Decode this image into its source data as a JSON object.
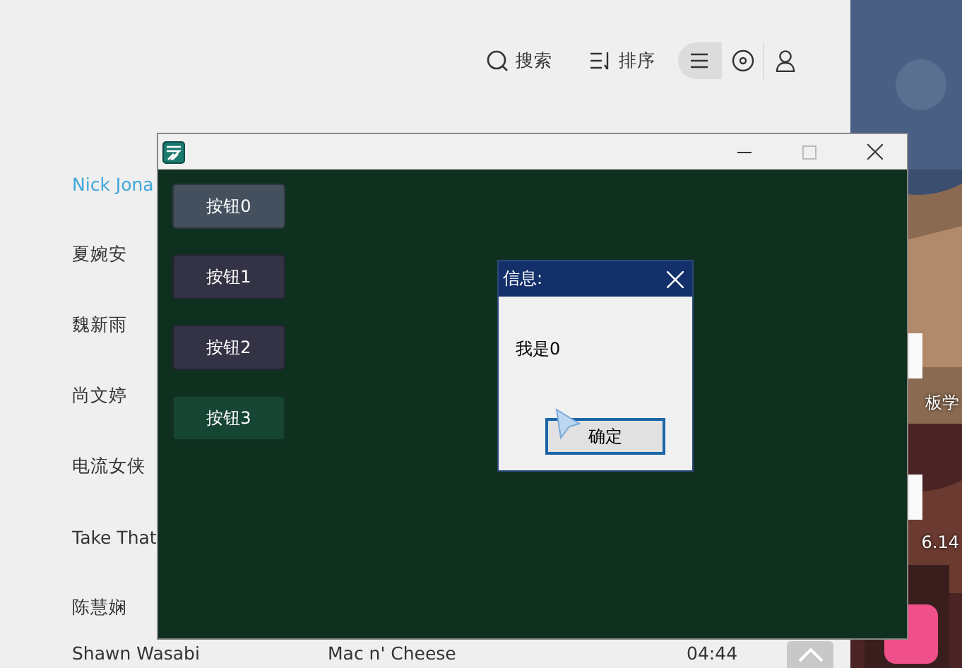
{
  "music_app": {
    "toolbar": [
      {
        "kind": "search",
        "label": "搜索"
      },
      {
        "kind": "sort",
        "label": "排序"
      }
    ],
    "view_switch": [
      {
        "kind": "list",
        "selected": true
      },
      {
        "kind": "disc",
        "selected": false
      },
      {
        "kind": "user",
        "selected": false
      }
    ],
    "artists": [
      {
        "name": "Nick Jona",
        "selected": true
      },
      {
        "name": "夏婉安",
        "selected": false
      },
      {
        "name": "魏新雨",
        "selected": false
      },
      {
        "name": "尚文婷",
        "selected": false
      },
      {
        "name": "电流女侠",
        "selected": false
      },
      {
        "name": "Take That",
        "selected": false
      },
      {
        "name": "陈慧娴",
        "selected": false
      }
    ],
    "track_row": {
      "artist": "Shawn Wasabi",
      "title": "Mac n' Cheese",
      "duration": "04:44"
    }
  },
  "window": {
    "buttons": [
      {
        "label": "按钮0",
        "color": "#44505e"
      },
      {
        "label": "按钮1",
        "color": "#333345"
      },
      {
        "label": "按钮2",
        "color": "#333345"
      },
      {
        "label": "按钮3",
        "color": "#174533"
      }
    ]
  },
  "dialog": {
    "title": "信息:",
    "message": "我是0",
    "button": {
      "label": "确定",
      "focused": true
    }
  },
  "desktop": {
    "icon_labels": [
      "板学",
      "6.14"
    ]
  }
}
